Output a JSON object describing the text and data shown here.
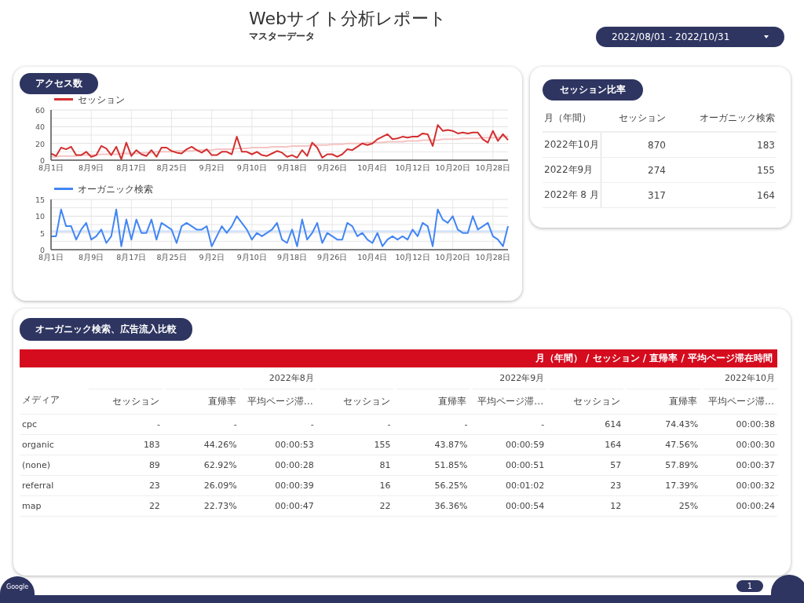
{
  "header": {
    "title": "Webサイト分析レポート",
    "subtitle": "マスターデータ",
    "date_range": {
      "value": "2022/08/01 - 2022/10/31"
    }
  },
  "access_card": {
    "title": "アクセス数",
    "charts": [
      {
        "chart_data": {
          "type": "line",
          "grid": true,
          "categories": [
            "8月1日",
            null,
            null,
            null,
            null,
            null,
            null,
            null,
            "8月9日",
            null,
            null,
            null,
            null,
            null,
            null,
            null,
            "8月17日",
            null,
            null,
            null,
            null,
            null,
            null,
            null,
            "8月25日",
            null,
            null,
            null,
            null,
            null,
            null,
            null,
            "9月2日",
            null,
            null,
            null,
            null,
            null,
            null,
            null,
            "9月10日",
            null,
            null,
            null,
            null,
            null,
            null,
            null,
            "9月18日",
            null,
            null,
            null,
            null,
            null,
            null,
            null,
            "9月26日",
            null,
            null,
            null,
            null,
            null,
            null,
            null,
            "10月4日",
            null,
            null,
            null,
            null,
            null,
            null,
            null,
            "10月12日",
            null,
            null,
            null,
            null,
            null,
            null,
            null,
            "10月20日",
            null,
            null,
            null,
            null,
            null,
            null,
            null,
            "10月28日",
            null,
            null,
            null
          ],
          "series": [
            {
              "name": "セッション",
              "color": "#d32f2f",
              "values": [
                8,
                5,
                15,
                13,
                16,
                6,
                6,
                10,
                4,
                6,
                17,
                14,
                6,
                16,
                1,
                21,
                5,
                12,
                7,
                5,
                12,
                4,
                15,
                15,
                11,
                9,
                8,
                13,
                16,
                12,
                9,
                13,
                6,
                6,
                10,
                10,
                7,
                28,
                10,
                10,
                7,
                10,
                6,
                5,
                8,
                11,
                9,
                4,
                6,
                3,
                12,
                5,
                21,
                15,
                3,
                7,
                7,
                4,
                7,
                13,
                12,
                16,
                20,
                18,
                20,
                25,
                28,
                31,
                25,
                26,
                28,
                27,
                28,
                28,
                32,
                31,
                17,
                42,
                35,
                36,
                35,
                32,
                33,
                32,
                33,
                33,
                25,
                21,
                35,
                23,
                31,
                24
              ]
            },
            {
              "color": "#f5c4c4",
              "values": [
                4,
                4,
                5,
                5,
                5,
                5,
                6,
                6,
                6,
                6,
                7,
                7,
                7,
                7,
                8,
                8,
                8,
                8,
                9,
                9,
                9,
                10,
                10,
                10,
                10,
                11,
                11,
                11,
                11,
                12,
                12,
                12,
                12,
                13,
                13,
                13,
                13,
                14,
                14,
                14,
                15,
                15,
                15,
                15,
                16,
                16,
                16,
                16,
                17,
                17,
                17,
                17,
                18,
                18,
                18,
                18,
                19,
                19,
                19,
                20,
                20,
                20,
                20,
                21,
                21,
                21,
                21,
                22,
                22,
                22,
                22,
                23,
                23,
                23,
                24,
                24,
                24,
                24,
                25,
                25,
                25,
                25,
                26,
                26,
                26,
                26,
                27,
                27,
                27,
                27,
                28,
                28
              ]
            }
          ],
          "ylim": [
            0,
            60
          ],
          "yticks": [
            0,
            20,
            40,
            60
          ]
        }
      },
      {
        "chart_data": {
          "type": "line",
          "grid": true,
          "categories": [
            "8月1日",
            null,
            null,
            null,
            null,
            null,
            null,
            null,
            "8月9日",
            null,
            null,
            null,
            null,
            null,
            null,
            null,
            "8月17日",
            null,
            null,
            null,
            null,
            null,
            null,
            null,
            "8月25日",
            null,
            null,
            null,
            null,
            null,
            null,
            null,
            "9月2日",
            null,
            null,
            null,
            null,
            null,
            null,
            null,
            "9月10日",
            null,
            null,
            null,
            null,
            null,
            null,
            null,
            "9月18日",
            null,
            null,
            null,
            null,
            null,
            null,
            null,
            "9月26日",
            null,
            null,
            null,
            null,
            null,
            null,
            null,
            "10月4日",
            null,
            null,
            null,
            null,
            null,
            null,
            null,
            "10月12日",
            null,
            null,
            null,
            null,
            null,
            null,
            null,
            "10月20日",
            null,
            null,
            null,
            null,
            null,
            null,
            null,
            "10月28日",
            null,
            null,
            null
          ],
          "series": [
            {
              "name": "オーガニック検索",
              "color": "#4285f4",
              "values": [
                4,
                4,
                12,
                7,
                7,
                3,
                6,
                8,
                3,
                4,
                6,
                2,
                4,
                12,
                1,
                9,
                3,
                9,
                5,
                5,
                9,
                3,
                8,
                7,
                6,
                2,
                7,
                8,
                7,
                6,
                6,
                7,
                1,
                4,
                7,
                5,
                7,
                10,
                8,
                6,
                3,
                5,
                4,
                5,
                6,
                8,
                3,
                2,
                6,
                1,
                9,
                3,
                5,
                8,
                2,
                5,
                4,
                3,
                3,
                8,
                7,
                4,
                5,
                3,
                2,
                5,
                1,
                3,
                4,
                3,
                4,
                3,
                6,
                4,
                8,
                7,
                1,
                12,
                9,
                8,
                10,
                6,
                5,
                5,
                10,
                6,
                7,
                8,
                4,
                3,
                1,
                7
              ]
            },
            {
              "color": "#c9dcf9",
              "values": [
                5.5,
                5.5,
                5.5,
                5.5,
                5.5,
                5.5,
                5.5,
                5.5,
                5.5,
                5.5,
                5.5,
                5.5,
                5.5,
                5.5,
                5.5,
                5.5,
                5.5,
                5.5,
                5.5,
                5.5,
                5.5,
                5.5,
                5.5,
                5.5,
                5.5,
                5.5,
                5.5,
                5.5,
                5.5,
                5.5,
                5.5,
                5.5,
                5.5,
                5.5,
                5.5,
                5.5,
                5.5,
                5.5,
                5.5,
                5.5,
                5.5,
                5.5,
                5.5,
                5.5,
                5.5,
                5.5,
                5.5,
                5.5,
                5.5,
                5.5,
                5.5,
                5.5,
                5.5,
                5.5,
                5.5,
                5.5,
                5.5,
                5.5,
                5.5,
                5.5,
                5.5,
                5.5,
                5.5,
                5.5,
                5.5,
                5.5,
                5.5,
                5.5,
                5.5,
                5.5,
                5.5,
                5.5,
                5.5,
                5.5,
                5.5,
                5.5,
                5.5,
                5.5,
                5.5,
                5.5,
                5.5,
                5.5,
                5.5,
                5.5,
                5.5,
                5.5,
                5.5,
                5.5,
                5.5,
                5.5,
                5.5,
                5.5
              ]
            }
          ],
          "ylim": [
            0,
            15
          ],
          "yticks": [
            0,
            5,
            10,
            15
          ]
        }
      }
    ]
  },
  "session_ratio": {
    "title": "セッション比率",
    "columns": [
      "月（年間）",
      "セッション",
      "オーガニック検索"
    ],
    "rows": [
      {
        "month": "2022年10月",
        "sessions": "870",
        "organic": "183"
      },
      {
        "month": "2022年9月",
        "sessions": "274",
        "organic": "155"
      },
      {
        "month": "2022年 8 月",
        "sessions": "317",
        "organic": "164"
      }
    ]
  },
  "comparison": {
    "title": "オーガニック検索、広告流入比較",
    "header_bar": "月（年間） / セッション / 直帰率 / 平均ページ滞在時間",
    "months": [
      "2022年8月",
      "2022年9月",
      "2022年10月"
    ],
    "dimension_label": "メディア",
    "columns": [
      "セッション",
      "直帰率",
      "平均ページ滞…",
      "セッション",
      "直帰率",
      "平均ページ滞…",
      "セッション",
      "直帰率",
      "平均ページ滞…"
    ],
    "rows": [
      {
        "media": "cpc",
        "cells": [
          "-",
          "-",
          "-",
          "-",
          "-",
          "-",
          "614",
          "74.43%",
          "00:00:38"
        ]
      },
      {
        "media": "organic",
        "cells": [
          "183",
          "44.26%",
          "00:00:53",
          "155",
          "43.87%",
          "00:00:59",
          "164",
          "47.56%",
          "00:00:30"
        ]
      },
      {
        "media": "(none)",
        "cells": [
          "89",
          "62.92%",
          "00:00:28",
          "81",
          "51.85%",
          "00:00:51",
          "57",
          "57.89%",
          "00:00:37"
        ]
      },
      {
        "media": "referral",
        "cells": [
          "23",
          "26.09%",
          "00:00:39",
          "16",
          "56.25%",
          "00:01:02",
          "23",
          "17.39%",
          "00:00:32"
        ]
      },
      {
        "media": "map",
        "cells": [
          "22",
          "22.73%",
          "00:00:47",
          "22",
          "36.36%",
          "00:00:54",
          "12",
          "25%",
          "00:00:24"
        ]
      }
    ]
  },
  "footer": {
    "brand": "Google",
    "page": "1"
  }
}
